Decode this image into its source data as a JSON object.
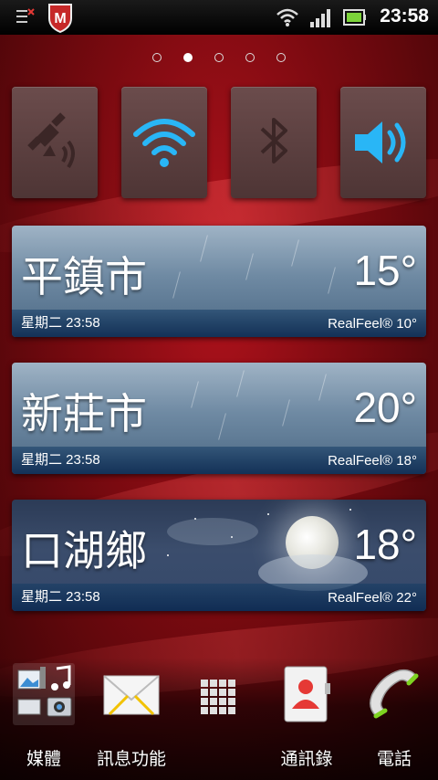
{
  "status_bar": {
    "time": "23:58",
    "icons": [
      "notification-icon",
      "mcafee-icon",
      "wifi-icon",
      "signal-icon",
      "battery-icon"
    ]
  },
  "home": {
    "page_count": 5,
    "active_page": 2
  },
  "toggles": [
    {
      "name": "gps-toggle",
      "icon": "gps-icon",
      "on": false
    },
    {
      "name": "wifi-toggle",
      "icon": "wifi-icon",
      "on": true
    },
    {
      "name": "bluetooth-toggle",
      "icon": "bluetooth-icon",
      "on": false
    },
    {
      "name": "sound-toggle",
      "icon": "speaker-icon",
      "on": true
    }
  ],
  "weather": [
    {
      "city": "平鎮市",
      "temp": "15°",
      "datetime": "星期二 23:58",
      "realfeel": "RealFeel® 10°",
      "condition": "rain"
    },
    {
      "city": "新莊市",
      "temp": "20°",
      "datetime": "星期二 23:58",
      "realfeel": "RealFeel® 18°",
      "condition": "rain"
    },
    {
      "city": "口湖鄉",
      "temp": "18°",
      "datetime": "星期二 23:58",
      "realfeel": "RealFeel® 22°",
      "condition": "clear-night"
    }
  ],
  "dock": [
    {
      "label": "媒體",
      "icon": "media-icon"
    },
    {
      "label": "訊息功能",
      "icon": "messaging-icon"
    },
    {
      "label": "",
      "icon": "app-drawer-icon"
    },
    {
      "label": "通訊錄",
      "icon": "contacts-icon"
    },
    {
      "label": "電話",
      "icon": "phone-icon"
    }
  ],
  "colors": {
    "accent": "#29b6f6",
    "toggle_off": "#3a2a2a",
    "wallpaper": "#b0121c"
  }
}
